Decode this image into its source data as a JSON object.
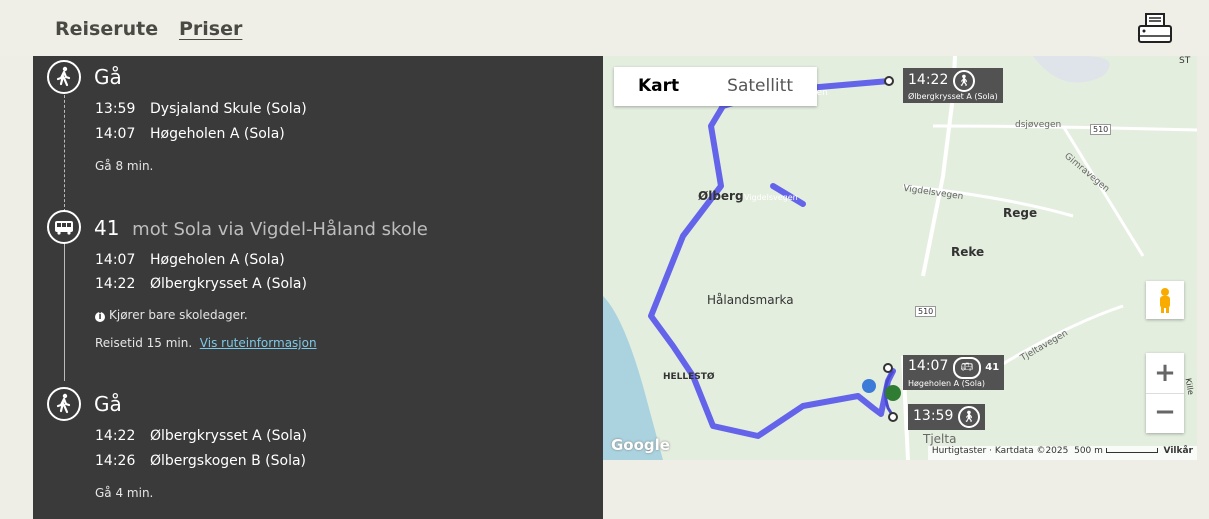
{
  "tabs": [
    {
      "label": "Reiserute"
    },
    {
      "label": "Priser"
    }
  ],
  "print_icon": "printer-icon",
  "legs": [
    {
      "icon": "walk-icon",
      "title": "Gå",
      "stops": [
        {
          "time": "13:59",
          "name": "Dysjaland Skule (Sola)"
        },
        {
          "time": "14:07",
          "name": "Høgeholen A (Sola)"
        }
      ],
      "duration": "Gå 8 min."
    },
    {
      "icon": "bus-icon",
      "route": "41",
      "direction": "mot Sola via Vigdel-Håland skole",
      "stops": [
        {
          "time": "14:07",
          "name": "Høgeholen A (Sola)"
        },
        {
          "time": "14:22",
          "name": "Ølbergkrysset A (Sola)"
        }
      ],
      "note": "Kjører bare skoledager.",
      "travel_time": "Reisetid 15 min.",
      "route_info_link": "Vis ruteinformasjon"
    },
    {
      "icon": "walk-icon",
      "title": "Gå",
      "stops": [
        {
          "time": "14:22",
          "name": "Ølbergkrysset A (Sola)"
        },
        {
          "time": "14:26",
          "name": "Ølbergskogen B (Sola)"
        }
      ],
      "duration": "Gå 4 min."
    }
  ],
  "map": {
    "toggle": {
      "map": "Kart",
      "satellite": "Satellitt"
    },
    "callouts": [
      {
        "time": "14:22",
        "sub": "Ølbergkrysset A (Sola)"
      },
      {
        "time": "14:07",
        "route": "41",
        "sub": "Høgeholen A (Sola)"
      },
      {
        "time": "13:59"
      }
    ],
    "labels": {
      "olberg": "Ølberg",
      "vigdelsvegen1": "Vigdelsvegen",
      "vigdelsvegen2": "Vigdelsvegen",
      "vegen": "vegen",
      "rege": "Rege",
      "reke": "Reke",
      "halandsmarka": "Hålandsmarka",
      "hellesto": "HELLESTØ",
      "tjelta": "Tjelta",
      "gimravegen": "Gimravegen",
      "dsjovegen": "dsjøvegen",
      "tjeltavegen": "Tjeltavegen",
      "road510a": "510",
      "road510b": "510",
      "st": "ST",
      "kille": "Kille"
    },
    "zoom_in": "+",
    "zoom_out": "−",
    "google": "Google",
    "attribution": {
      "shortcuts": "Hurtigtaster",
      "data": "Kartdata ©2025",
      "scale": "500 m",
      "terms": "Vilkår"
    }
  },
  "colors": {
    "route": "#6464ea",
    "panel": "#3a3a3a",
    "background": "#efefe7"
  }
}
